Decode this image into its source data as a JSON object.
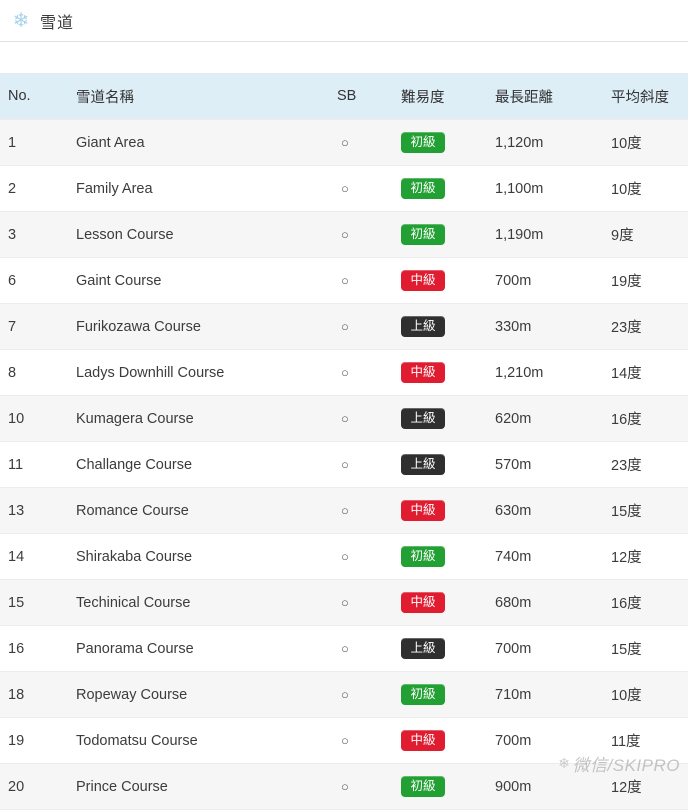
{
  "header": {
    "icon": "snowflake-icon",
    "icon_glyph": "❄",
    "title": "雪道"
  },
  "table": {
    "columns": [
      {
        "key": "no",
        "label": "No."
      },
      {
        "key": "name",
        "label": "雪道名稱"
      },
      {
        "key": "sb",
        "label": "SB"
      },
      {
        "key": "diff",
        "label": "難易度"
      },
      {
        "key": "dist",
        "label": "最長距離"
      },
      {
        "key": "slope",
        "label": "平均斜度"
      }
    ],
    "sb_mark": "○",
    "difficulty_labels": {
      "beginner": "初級",
      "middle": "中級",
      "advanced": "上級"
    },
    "difficulty_colors": {
      "beginner": "#22a033",
      "middle": "#e01c30",
      "advanced": "#2f2f2f"
    },
    "header_bg": "#ddeef7",
    "rows": [
      {
        "no": "1",
        "name": "Giant Area",
        "sb": "○",
        "diff": "初級",
        "diff_class": "badge-beginner",
        "dist": "1,120m",
        "slope": "10度"
      },
      {
        "no": "2",
        "name": "Family Area",
        "sb": "○",
        "diff": "初級",
        "diff_class": "badge-beginner",
        "dist": "1,100m",
        "slope": "10度"
      },
      {
        "no": "3",
        "name": "Lesson Course",
        "sb": "○",
        "diff": "初級",
        "diff_class": "badge-beginner",
        "dist": "1,190m",
        "slope": "9度"
      },
      {
        "no": "6",
        "name": "Gaint Course",
        "sb": "○",
        "diff": "中級",
        "diff_class": "badge-middle",
        "dist": "700m",
        "slope": "19度"
      },
      {
        "no": "7",
        "name": "Furikozawa Course",
        "sb": "○",
        "diff": "上級",
        "diff_class": "badge-advanced",
        "dist": "330m",
        "slope": "23度"
      },
      {
        "no": "8",
        "name": "Ladys Downhill Course",
        "sb": "○",
        "diff": "中級",
        "diff_class": "badge-middle",
        "dist": "1,210m",
        "slope": "14度"
      },
      {
        "no": "10",
        "name": "Kumagera Course",
        "sb": "○",
        "diff": "上級",
        "diff_class": "badge-advanced",
        "dist": "620m",
        "slope": "16度"
      },
      {
        "no": "11",
        "name": "Challange Course",
        "sb": "○",
        "diff": "上級",
        "diff_class": "badge-advanced",
        "dist": "570m",
        "slope": "23度"
      },
      {
        "no": "13",
        "name": "Romance Course",
        "sb": "○",
        "diff": "中級",
        "diff_class": "badge-middle",
        "dist": "630m",
        "slope": "15度"
      },
      {
        "no": "14",
        "name": "Shirakaba Course",
        "sb": "○",
        "diff": "初級",
        "diff_class": "badge-beginner",
        "dist": "740m",
        "slope": "12度"
      },
      {
        "no": "15",
        "name": "Techinical Course",
        "sb": "○",
        "diff": "中級",
        "diff_class": "badge-middle",
        "dist": "680m",
        "slope": "16度"
      },
      {
        "no": "16",
        "name": "Panorama Course",
        "sb": "○",
        "diff": "上級",
        "diff_class": "badge-advanced",
        "dist": "700m",
        "slope": "15度"
      },
      {
        "no": "18",
        "name": "Ropeway Course",
        "sb": "○",
        "diff": "初級",
        "diff_class": "badge-beginner",
        "dist": "710m",
        "slope": "10度"
      },
      {
        "no": "19",
        "name": "Todomatsu Course",
        "sb": "○",
        "diff": "中級",
        "diff_class": "badge-middle",
        "dist": "700m",
        "slope": "11度"
      },
      {
        "no": "20",
        "name": "Prince Course",
        "sb": "○",
        "diff": "初級",
        "diff_class": "badge-beginner",
        "dist": "900m",
        "slope": "12度"
      }
    ]
  },
  "watermark": {
    "icon_glyph": "❄",
    "text": "微信/SKIPRO"
  }
}
